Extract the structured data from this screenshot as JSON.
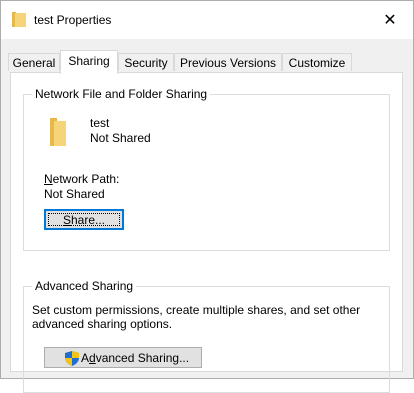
{
  "window": {
    "title": "test Properties",
    "close_symbol": "✕",
    "icon": "folder-icon"
  },
  "tabs": [
    {
      "label": "General",
      "active": false
    },
    {
      "label": "Sharing",
      "active": true
    },
    {
      "label": "Security",
      "active": false
    },
    {
      "label": "Previous Versions",
      "active": false
    },
    {
      "label": "Customize",
      "active": false
    }
  ],
  "network_sharing": {
    "group_label": "Network File and Folder Sharing",
    "folder_name": "test",
    "share_status": "Not Shared",
    "path_label_prefix": "N",
    "path_label_rest": "etwork Path:",
    "path_value": "Not Shared",
    "share_button_prefix": "S",
    "share_button_rest": "hare..."
  },
  "advanced_sharing": {
    "group_label": "Advanced Sharing",
    "description_line1": "Set custom permissions, create multiple shares, and set other",
    "description_line2": "advanced sharing options.",
    "button_prefix": "A",
    "button_underlined": "d",
    "button_rest": "vanced Sharing...",
    "button_icon": "shield-icon"
  },
  "colors": {
    "folder_yellow": "#f6d57a",
    "folder_dark": "#e6b94a",
    "focus_blue": "#0078d7",
    "shield_blue": "#1f6fd0",
    "shield_yellow": "#f2c418"
  }
}
